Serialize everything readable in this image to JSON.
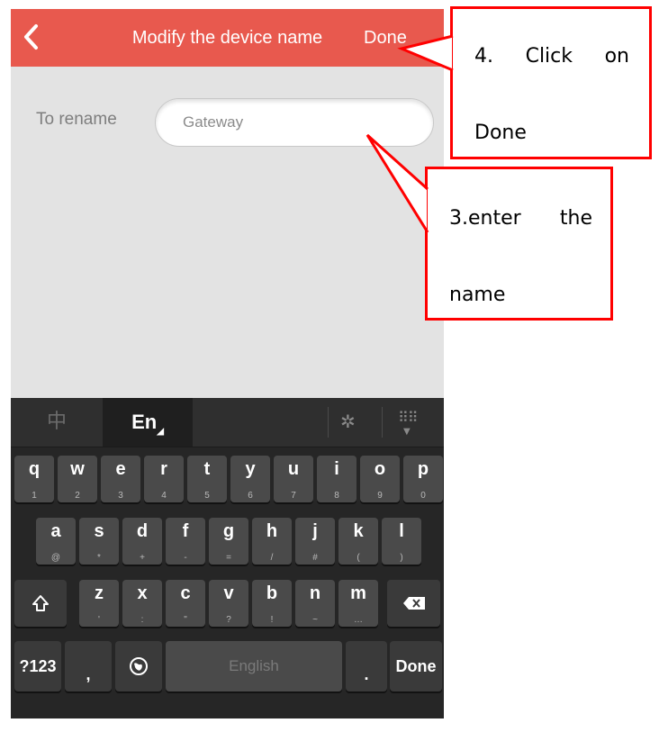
{
  "app": {
    "header": {
      "back_icon": "chevron-left-icon",
      "title": "Modify the device name",
      "done_label": "Done",
      "color": "#e8594e"
    },
    "rename": {
      "label": "To rename",
      "input_value": "Gateway"
    },
    "keyboard": {
      "lang_zh": "中",
      "lang_en": "En",
      "settings_icon": "gear-icon",
      "hide_icon": "keyboard-hide-icon",
      "row1": [
        {
          "main": "q",
          "sub": "1"
        },
        {
          "main": "w",
          "sub": "2"
        },
        {
          "main": "e",
          "sub": "3"
        },
        {
          "main": "r",
          "sub": "4"
        },
        {
          "main": "t",
          "sub": "5"
        },
        {
          "main": "y",
          "sub": "6"
        },
        {
          "main": "u",
          "sub": "7"
        },
        {
          "main": "i",
          "sub": "8"
        },
        {
          "main": "o",
          "sub": "9"
        },
        {
          "main": "p",
          "sub": "0"
        }
      ],
      "row2": [
        {
          "main": "a",
          "sub": "@"
        },
        {
          "main": "s",
          "sub": "*"
        },
        {
          "main": "d",
          "sub": "+"
        },
        {
          "main": "f",
          "sub": "-"
        },
        {
          "main": "g",
          "sub": "="
        },
        {
          "main": "h",
          "sub": "/"
        },
        {
          "main": "j",
          "sub": "#"
        },
        {
          "main": "k",
          "sub": "("
        },
        {
          "main": "l",
          "sub": ")"
        }
      ],
      "row3": [
        {
          "main": "z",
          "sub": "'"
        },
        {
          "main": "x",
          "sub": ":"
        },
        {
          "main": "c",
          "sub": "\""
        },
        {
          "main": "v",
          "sub": "?"
        },
        {
          "main": "b",
          "sub": "!"
        },
        {
          "main": "n",
          "sub": "~"
        },
        {
          "main": "m",
          "sub": "…"
        }
      ],
      "shift_icon": "shift-icon",
      "backspace_icon": "backspace-icon",
      "numbers_label": "?123",
      "comma_label": ",",
      "globe_icon": "globe-icon",
      "space_label": "English",
      "period_label": ".",
      "done_label": "Done"
    }
  },
  "annotations": {
    "step4": {
      "line1": [
        "4.",
        "Click",
        "on"
      ],
      "line2": "Done"
    },
    "step3": {
      "line1": [
        "3.enter",
        "the"
      ],
      "line2": "name"
    },
    "color": "#ff0000"
  }
}
